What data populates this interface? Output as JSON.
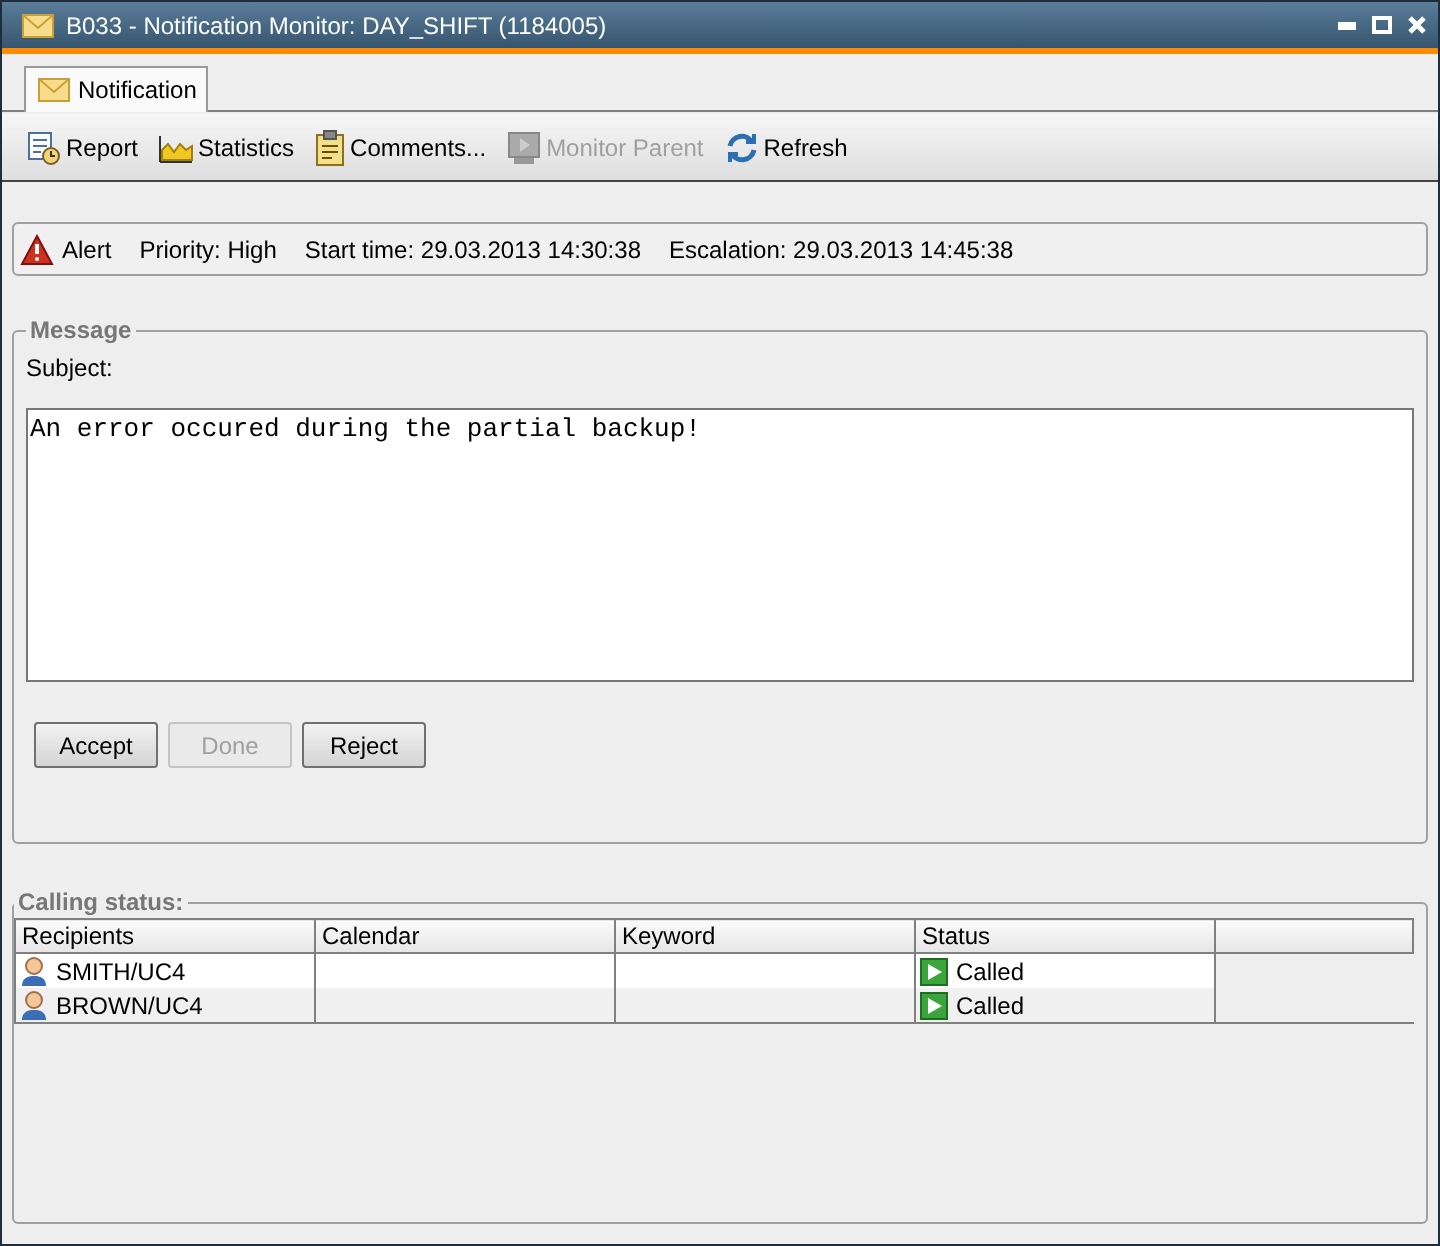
{
  "window": {
    "title": "B033 - Notification Monitor: DAY_SHIFT (1184005)"
  },
  "tabs": [
    {
      "label": "Notification",
      "selected": true
    }
  ],
  "toolbar": [
    {
      "kind": "report",
      "label": "Report",
      "disabled": false
    },
    {
      "kind": "statistics",
      "label": "Statistics",
      "disabled": false
    },
    {
      "kind": "comments",
      "label": "Comments...",
      "disabled": false
    },
    {
      "kind": "monitor",
      "label": "Monitor Parent",
      "disabled": true
    },
    {
      "kind": "refresh",
      "label": "Refresh",
      "disabled": false
    }
  ],
  "info": {
    "alert": "Alert",
    "priority": "Priority: High",
    "start_time": "Start time: 29.03.2013 14:30:38",
    "escalation": "Escalation: 29.03.2013 14:45:38"
  },
  "message": {
    "legend": "Message",
    "subject_label": "Subject:",
    "body": "An error occured during the partial backup!",
    "buttons": [
      {
        "label": "Accept",
        "disabled": false
      },
      {
        "label": "Done",
        "disabled": true
      },
      {
        "label": "Reject",
        "disabled": false
      }
    ]
  },
  "calling_status": {
    "legend": "Calling status:",
    "columns": [
      "Recipients",
      "Calendar",
      "Keyword",
      "Status"
    ],
    "rows": [
      {
        "recipient": "SMITH/UC4",
        "status": "Called"
      },
      {
        "recipient": "BROWN/UC4",
        "status": "Called"
      }
    ]
  }
}
